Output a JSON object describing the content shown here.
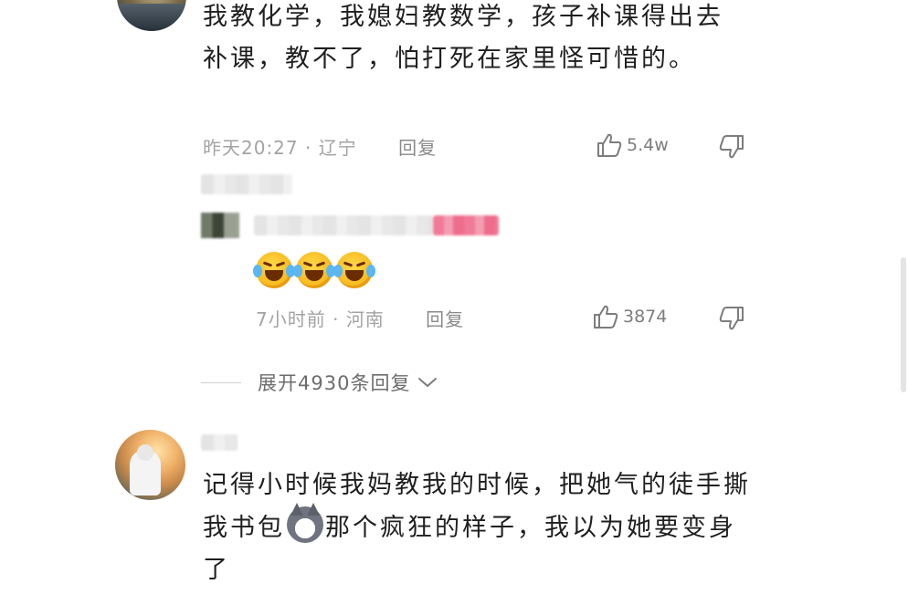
{
  "comments": [
    {
      "text": "我教化学，我媳妇教数学，孩子补课得出去补课，教不了，怕打死在家里怪可惜的。",
      "time": "昨天20:27",
      "location": "辽宁",
      "reply_label": "回复",
      "likes": "5.4w"
    },
    {
      "text": "记得小时候我妈教我的时候，把她气的徒手撕我书包",
      "text_after_emoji": "那个疯狂的样子，我以为她要变身了",
      "inline_emoji": "husky-dog-emoji"
    }
  ],
  "reply": {
    "emojis": [
      "laugh-cry-emoji",
      "laugh-cry-emoji",
      "laugh-cry-emoji"
    ],
    "time": "7小时前",
    "location": "河南",
    "reply_label": "回复",
    "likes": "3874"
  },
  "expand": {
    "label": "展开4930条回复"
  },
  "separator": "·",
  "icons": {
    "like": "thumbs-up-icon",
    "dislike": "thumbs-down-icon",
    "expand": "chevron-down-icon"
  }
}
